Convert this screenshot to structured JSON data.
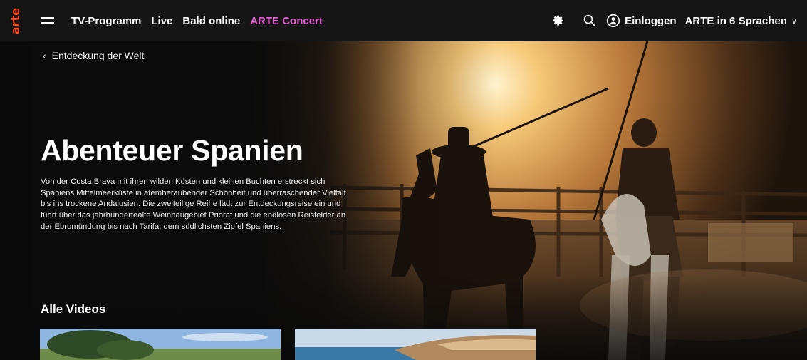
{
  "brand": {
    "logo_text": "arte",
    "logo_color": "#fa481c"
  },
  "nav": {
    "items": [
      {
        "label": "TV-Programm"
      },
      {
        "label": "Live"
      },
      {
        "label": "Bald online"
      },
      {
        "label": "ARTE Concert",
        "color": "#e45fd4"
      }
    ]
  },
  "tools": {
    "settings_icon": "gear-icon",
    "search_icon": "search-icon",
    "login_label": "Einloggen",
    "language_label": "ARTE in 6 Sprachen"
  },
  "breadcrumb": {
    "label": "Entdeckung der Welt"
  },
  "hero": {
    "title": "Abenteuer Spanien",
    "description": "Von der Costa Brava mit ihren wilden Küsten und kleinen Buchten erstreckt sich Spaniens Mittelmeerküste in atemberaubender Schönheit und überraschender Vielfalt bis ins trockene Andalusien. Die zweiteilige Reihe lädt zur Entdeckungsreise ein und führt über das jahrhundertealte Weinbaugebiet Priorat und die endlosen Reisfelder an der Ebromündung bis nach Tarifa, dem südlichsten Zipfel Spaniens."
  },
  "videos": {
    "section_title": "Alle Videos",
    "items": [
      {
        "thumb_name": "coastal-pine-thumbnail"
      },
      {
        "thumb_name": "coastal-hill-thumbnail"
      }
    ]
  }
}
